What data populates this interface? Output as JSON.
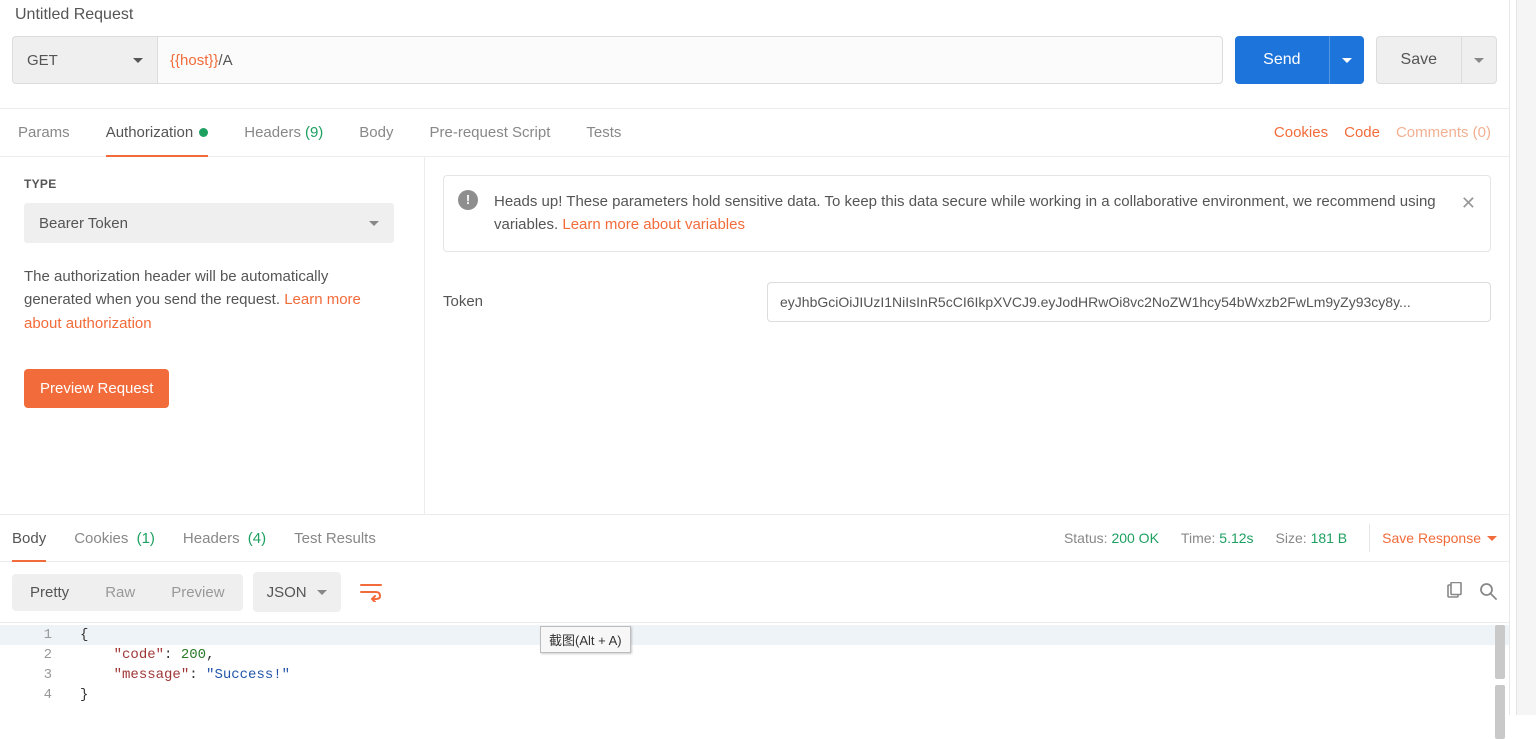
{
  "title": "Untitled Request",
  "request": {
    "method": "GET",
    "url_variable": "{{host}}",
    "url_path": "/A",
    "send_label": "Send",
    "save_label": "Save"
  },
  "tabs": {
    "params": "Params",
    "authorization": "Authorization",
    "headers": "Headers",
    "headers_count": "(9)",
    "body": "Body",
    "prerequest": "Pre-request Script",
    "tests": "Tests"
  },
  "right_links": {
    "cookies": "Cookies",
    "code": "Code",
    "comments": "Comments (0)"
  },
  "auth": {
    "type_label": "TYPE",
    "type_value": "Bearer Token",
    "note_pre": "The authorization header will be automatically generated when you send the request. ",
    "note_link": "Learn more about authorization",
    "preview_btn": "Preview Request",
    "alert_text": "Heads up! These parameters hold sensitive data. To keep this data secure while working in a collaborative environment, we recommend using variables. ",
    "alert_link": "Learn more about variables",
    "token_label": "Token",
    "token_value": "eyJhbGciOiJIUzI1NiIsInR5cCI6IkpXVCJ9.eyJodHRwOi8vc2NoZW1hcy54bWxzb2FwLm9yZy93cy8y..."
  },
  "response_tabs": {
    "body": "Body",
    "cookies": "Cookies",
    "cookies_count": "(1)",
    "headers": "Headers",
    "headers_count": "(4)",
    "test_results": "Test Results"
  },
  "response_status": {
    "status_label": "Status:",
    "status_value": "200 OK",
    "time_label": "Time:",
    "time_value": "5.12s",
    "size_label": "Size:",
    "size_value": "181 B",
    "save_response": "Save Response"
  },
  "response_toolbar": {
    "pretty": "Pretty",
    "raw": "Raw",
    "preview": "Preview",
    "format": "JSON"
  },
  "response_body": {
    "lines": [
      "1",
      "2",
      "3",
      "4"
    ],
    "code_key": "\"code\"",
    "code_val": "200",
    "message_key": "\"message\"",
    "message_val": "\"Success!\""
  },
  "tooltip": "截图(Alt + A)"
}
